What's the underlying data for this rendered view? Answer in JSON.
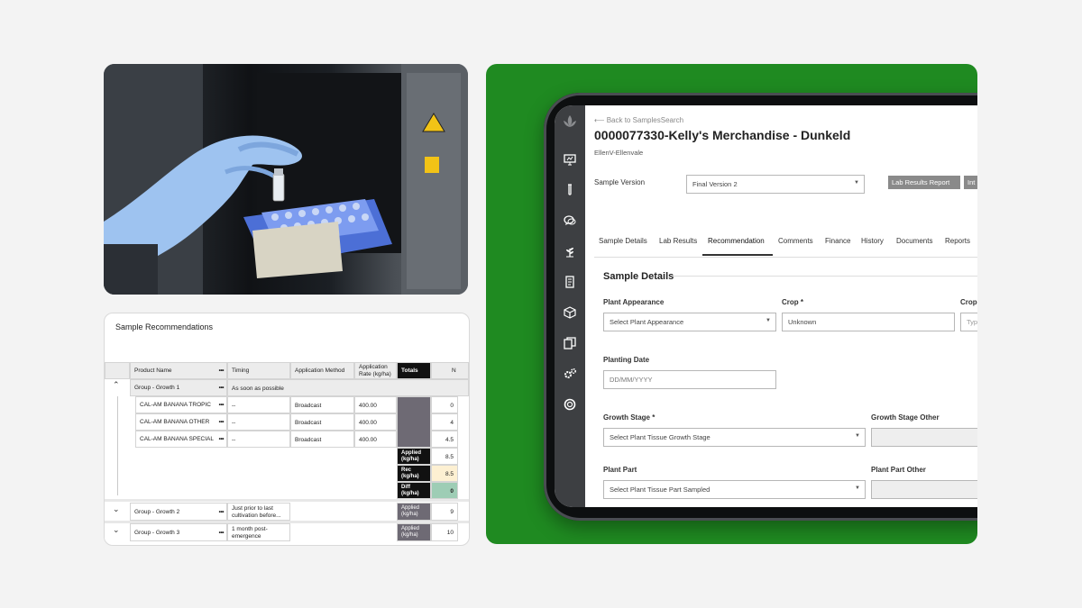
{
  "recommendations": {
    "title": "Sample Recommendations",
    "headers": {
      "product_name": "Product Name",
      "timing": "Timing",
      "application_method": "Application Method",
      "application_rate": "Application Rate (kg/ha)",
      "totals": "Totals",
      "n": "N"
    },
    "menu_glyph": "•••",
    "groups": [
      {
        "name": "Group - Growth 1",
        "timing": "As soon as possible",
        "expanded": true,
        "products": [
          {
            "name": "CAL-AM BANANA TROPIC",
            "timing": "--",
            "method": "Broadcast",
            "rate": "400.00",
            "n": "0"
          },
          {
            "name": "CAL-AM BANANA OTHER",
            "timing": "--",
            "method": "Broadcast",
            "rate": "400.00",
            "n": "4"
          },
          {
            "name": "CAL-AM BANANA SPECIAL",
            "timing": "--",
            "method": "Broadcast",
            "rate": "400.00",
            "n": "4.5"
          }
        ],
        "totals": [
          {
            "label": "Applied (kg/ha)",
            "n": "8.5"
          },
          {
            "label": "Rec (kg/ha)",
            "n": "8.5"
          },
          {
            "label": "Diff (kg/ha)",
            "n": "0"
          }
        ]
      },
      {
        "name": "Group - Growth 2",
        "timing": "Just prior to last cultivation before...",
        "total_label": "Applied (kg/ha)",
        "n": "9"
      },
      {
        "name": "Group - Growth 3",
        "timing": "1 month post-emergence",
        "total_label": "Applied (kg/ha)",
        "n": "10"
      }
    ],
    "colors": {
      "rec_highlight": "#fdf0d2",
      "diff_highlight": "#9ecdb5"
    }
  },
  "tablet": {
    "back_link": "Back to SamplesSearch",
    "page_title": "0000077330-Kelly's Merchandise - Dunkeld",
    "subtitle": "EllenV-Ellenvale",
    "sample_version_label": "Sample Version",
    "sample_version_value": "Final Version 2",
    "buttons": {
      "lab_results_report": "Lab Results Report",
      "truncated": "Int"
    },
    "tabs": [
      "Sample Details",
      "Lab Results",
      "Recommendation",
      "Comments",
      "Finance",
      "History",
      "Documents",
      "Reports"
    ],
    "active_tab": "Recommendation",
    "section_title": "Sample Details",
    "fields": {
      "plant_appearance": {
        "label": "Plant Appearance",
        "value": "Select Plant Appearance"
      },
      "crop": {
        "label": "Crop",
        "value": "Unknown"
      },
      "crop_other": {
        "label": "Crop",
        "value": "Typ"
      },
      "planting_date": {
        "label": "Planting Date",
        "placeholder": "DD/MM/YYYY"
      },
      "growth_stage": {
        "label": "Growth Stage",
        "value": "Select Plant Tissue Growth Stage"
      },
      "growth_stage_other": {
        "label": "Growth Stage Other",
        "value": ""
      },
      "plant_part": {
        "label": "Plant Part",
        "value": "Select Plant Tissue Part Sampled"
      },
      "plant_part_other": {
        "label": "Plant Part Other",
        "value": ""
      }
    },
    "required_mark": "*",
    "sidebar_icons": [
      "leaf-logo-icon",
      "presentation-icon",
      "test-tube-icon",
      "chat-icon",
      "plant-icon",
      "document-icon",
      "box-icon",
      "copy-icon",
      "gears-icon",
      "lifebuoy-icon"
    ]
  },
  "theme": {
    "panel_green": "#1f8a21",
    "sidebar": "#3d3f42"
  }
}
